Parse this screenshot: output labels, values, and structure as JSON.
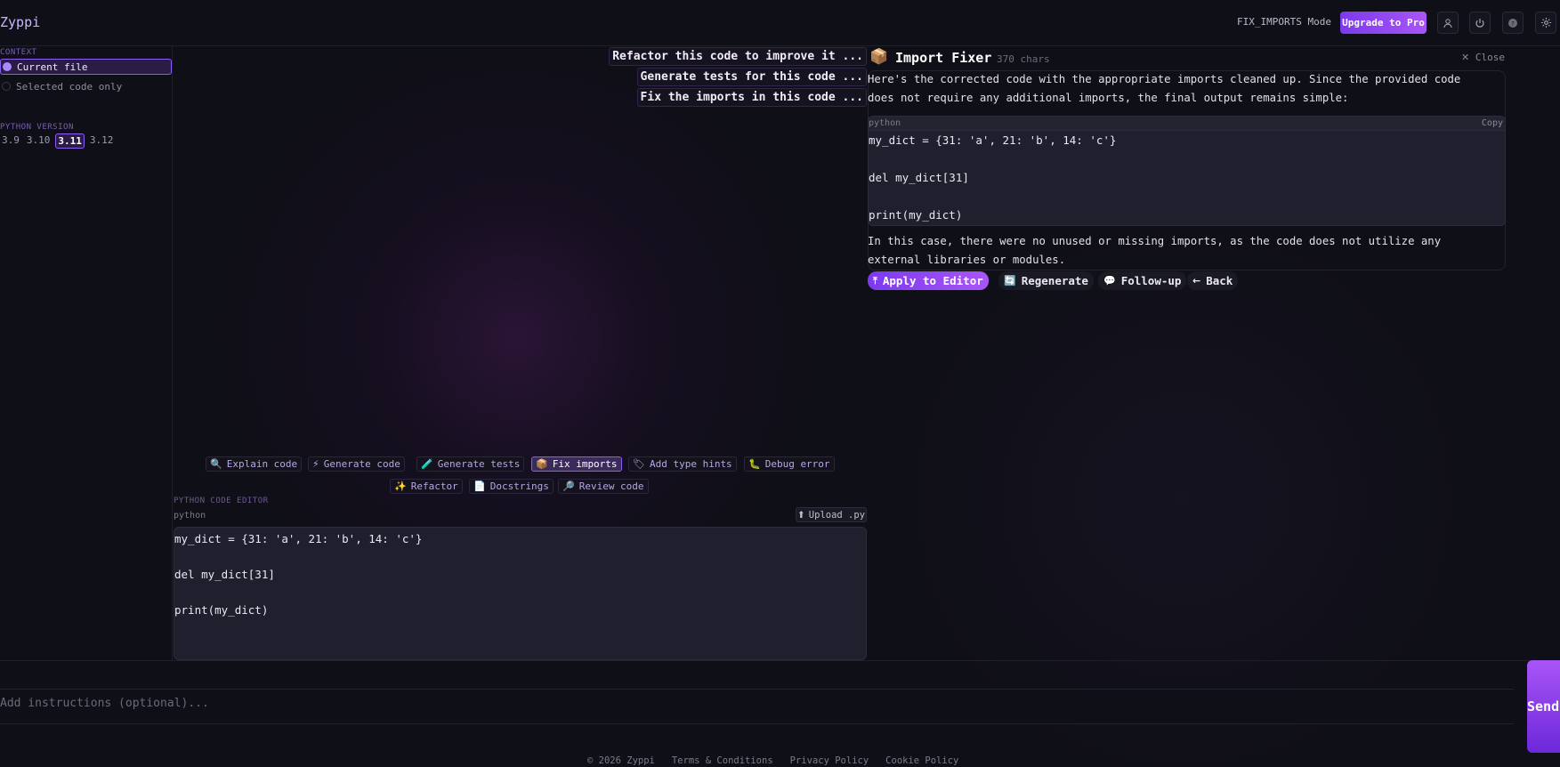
{
  "app": {
    "brand": "Zyppi"
  },
  "header": {
    "mode": "FIX_IMPORTS Mode",
    "upgrade_label": "Upgrade to Pro",
    "icons": [
      "user-icon",
      "power-icon",
      "help-icon",
      "settings-icon"
    ]
  },
  "sidebar": {
    "context_label": "CONTEXT",
    "context_options": [
      {
        "label": "Current file",
        "selected": true
      },
      {
        "label": "Selected code only",
        "selected": false
      }
    ],
    "python_version_label": "PYTHON VERSION",
    "versions": [
      {
        "label": "3.9",
        "selected": false
      },
      {
        "label": "3.10",
        "selected": false
      },
      {
        "label": "3.11",
        "selected": true
      },
      {
        "label": "3.12",
        "selected": false
      }
    ]
  },
  "suggestions": [
    "Refactor this code to improve it ...",
    "Generate tests for this code ...",
    "Fix the imports in this code ..."
  ],
  "actions": {
    "row1": [
      {
        "icon": "🔍",
        "icon_name": "magnifier-icon",
        "label": "Explain code",
        "active": false
      },
      {
        "icon": "⚡",
        "icon_name": "lightning-icon",
        "label": "Generate code",
        "active": false
      },
      {
        "icon": "🧪",
        "icon_name": "test-tube-icon",
        "label": "Generate tests",
        "active": false
      },
      {
        "icon": "📦",
        "icon_name": "package-icon",
        "label": "Fix imports",
        "active": true
      },
      {
        "icon": "🏷",
        "icon_name": "tag-icon",
        "label": "Add type hints",
        "active": false
      },
      {
        "icon": "🐛",
        "icon_name": "bug-icon",
        "label": "Debug error",
        "active": false
      }
    ],
    "row2": [
      {
        "icon": "✨",
        "icon_name": "sparkles-icon",
        "label": "Refactor",
        "active": false
      },
      {
        "icon": "📄",
        "icon_name": "document-icon",
        "label": "Docstrings",
        "active": false
      },
      {
        "icon": "🔎",
        "icon_name": "review-icon",
        "label": "Review code",
        "active": false
      }
    ]
  },
  "editor": {
    "section_label": "PYTHON CODE EDITOR",
    "language": "python",
    "upload_label": "Upload .py",
    "code": [
      "my_dict = {31: 'a', 21: 'b', 14: 'c'}",
      "",
      "del my_dict[31]",
      "",
      "print(my_dict)"
    ]
  },
  "response": {
    "icon": "📦",
    "title": "Import Fixer",
    "chars": "370 chars",
    "close_label": "Close",
    "intro_lines": [
      "Here's the corrected code with the appropriate imports cleaned up. Since the provided code",
      "does not require any additional imports, the final output remains simple:"
    ],
    "code_lang": "python",
    "copy_label": "Copy",
    "code": [
      "my_dict = {31: 'a', 21: 'b', 14: 'c'}",
      "",
      "del my_dict[31]",
      "",
      "print(my_dict)"
    ],
    "outro_lines": [
      "In this case, there were no unused or missing imports, as the code does not utilize any",
      "external libraries or modules."
    ],
    "buttons": [
      {
        "icon": "⤒",
        "label": "Apply to Editor"
      },
      {
        "icon": "🔄",
        "label": "Regenerate"
      },
      {
        "icon": "💬",
        "label": "Follow-up"
      },
      {
        "icon": "←",
        "label": "Back"
      }
    ]
  },
  "input": {
    "placeholder": "Add instructions (optional)...",
    "send_label": "Send"
  },
  "footer": {
    "copyright": "© 2026 Zyppi",
    "links": [
      "Terms & Conditions",
      "Privacy Policy",
      "Cookie Policy"
    ]
  },
  "colors": {
    "accent": "#8b5cf6",
    "accent_gradient_start": "#7c3aed",
    "accent_gradient_end": "#a855f7",
    "background": "#0f0f17"
  }
}
